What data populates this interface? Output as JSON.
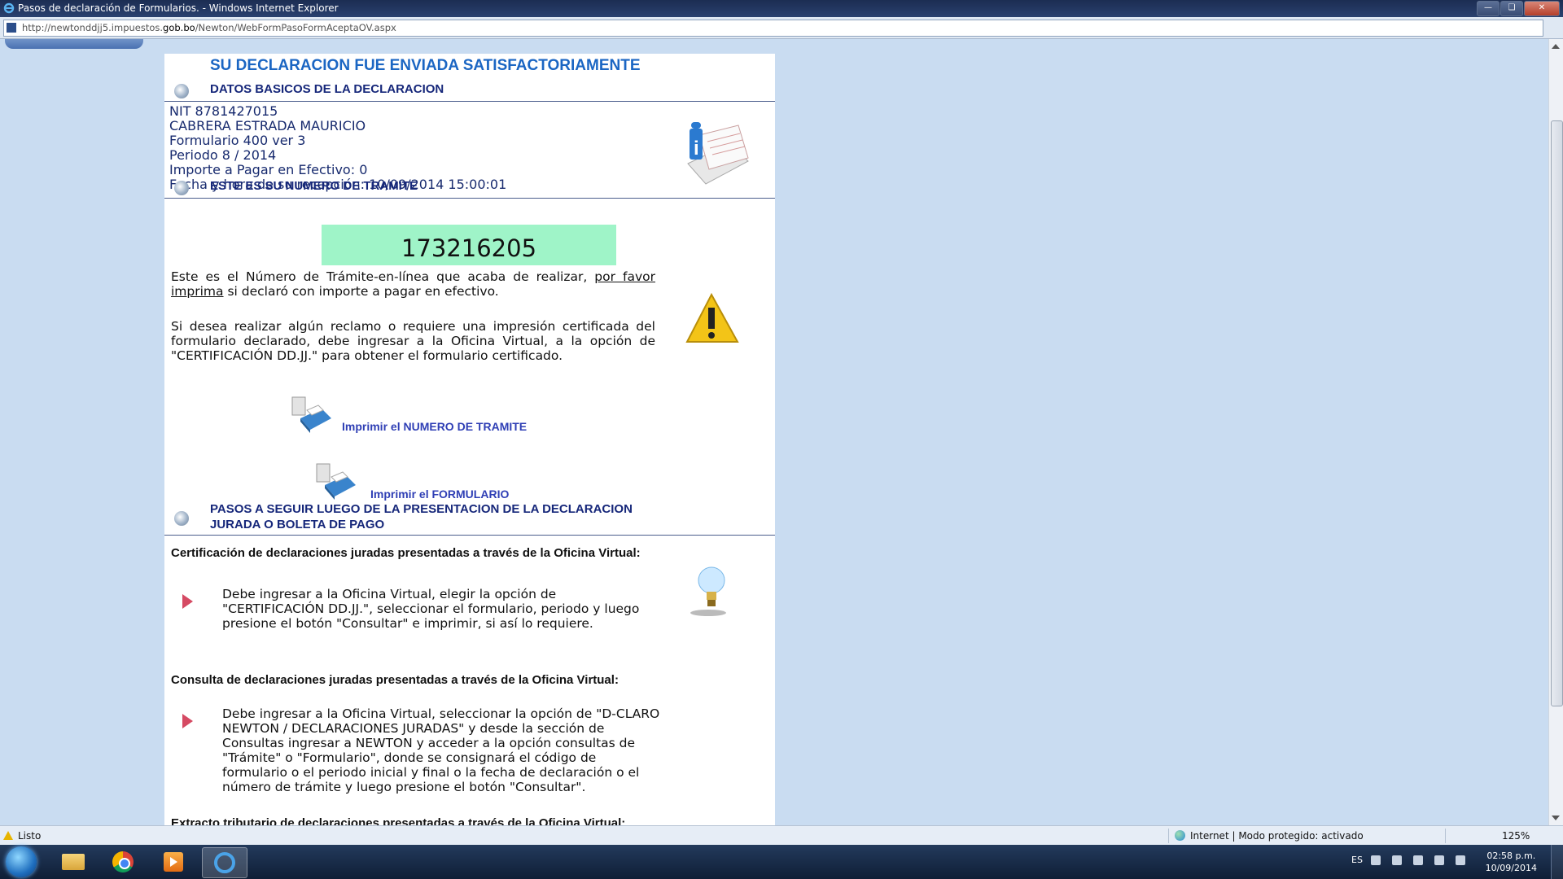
{
  "window": {
    "title": "Pasos de declaración de Formularios. - Windows Internet Explorer",
    "url_prefix": "http://newtonddjj5.impuestos.",
    "url_domain": "gob.bo",
    "url_suffix": "/Newton/WebFormPasoFormAceptaOV.aspx"
  },
  "page": {
    "main_title": "SU DECLARACION FUE ENVIADA SATISFACTORIAMENTE",
    "section1_title": "DATOS BASICOS DE LA DECLARACION",
    "basic": {
      "nit": "NIT  8781427015",
      "name": "CABRERA ESTRADA MAURICIO",
      "form": "Formulario 400 ver 3",
      "period": "Periodo  8 / 2014",
      "amount": "Importe a Pagar en Efectivo:  0",
      "received": "Fecha y hora de su recepción: 10/09/2014 15:00:01"
    },
    "section2_title": "ESTE ES SU NUMERO DE TRAMITE",
    "tramite_number": "173216205",
    "para1_a": "Este es el Número de Trámite-en-línea que acaba de realizar, ",
    "para1_link": "por favor imprima",
    "para1_b": " si declaró con importe a pagar en efectivo.",
    "para2": "Si desea realizar algún reclamo o requiere una impresión certificada del formulario declarado, debe ingresar a la Oficina Virtual, a la opción de \"CERTIFICACIÓN DD.JJ.\" para obtener el formulario certificado.",
    "print_tramite_label": "Imprimir el NUMERO DE TRAMITE",
    "print_form_label": "Imprimir el FORMULARIO",
    "section3_title": "PASOS A SEGUIR LUEGO DE LA PRESENTACION DE LA DECLARACION JURADA O BOLETA DE PAGO",
    "cert_heading": "Certificación de declaraciones juradas presentadas a través de la Oficina Virtual:",
    "cert_step": "Debe ingresar a la Oficina Virtual, elegir la opción de \"CERTIFICACIÓN DD.JJ.\", seleccionar el formulario, periodo y luego presione el botón \"Consultar\" e imprimir, si así lo requiere.",
    "consulta_heading": "Consulta de declaraciones juradas presentadas a través de la Oficina Virtual:",
    "consulta_step": "Debe ingresar a la Oficina Virtual, seleccionar la opción de \"D-CLARO NEWTON / DECLARACIONES JURADAS\" y desde la sección de Consultas ingresar a NEWTON y acceder a la opción consultas de \"Trámite\" o \"Formulario\", donde se consignará el código de formulario o el periodo inicial y final o la fecha de declaración o el número de trámite y luego presione el botón \"Consultar\".",
    "extracto_heading": "Extracto tributario de declaraciones presentadas a través de la Oficina Virtual:"
  },
  "status": {
    "left": "Listo",
    "zone": "Internet | Modo protegido: activado",
    "zoom": "125%"
  },
  "taskbar": {
    "lang": "ES",
    "time": "02:58 p.m.",
    "date": "10/09/2014"
  },
  "colors": {
    "title_blue": "#1b66c3",
    "section_navy": "#16277a",
    "tramite_bg": "#9ff4c8",
    "link_blue": "#2f3fb5",
    "page_bg": "#c9dcf1"
  }
}
